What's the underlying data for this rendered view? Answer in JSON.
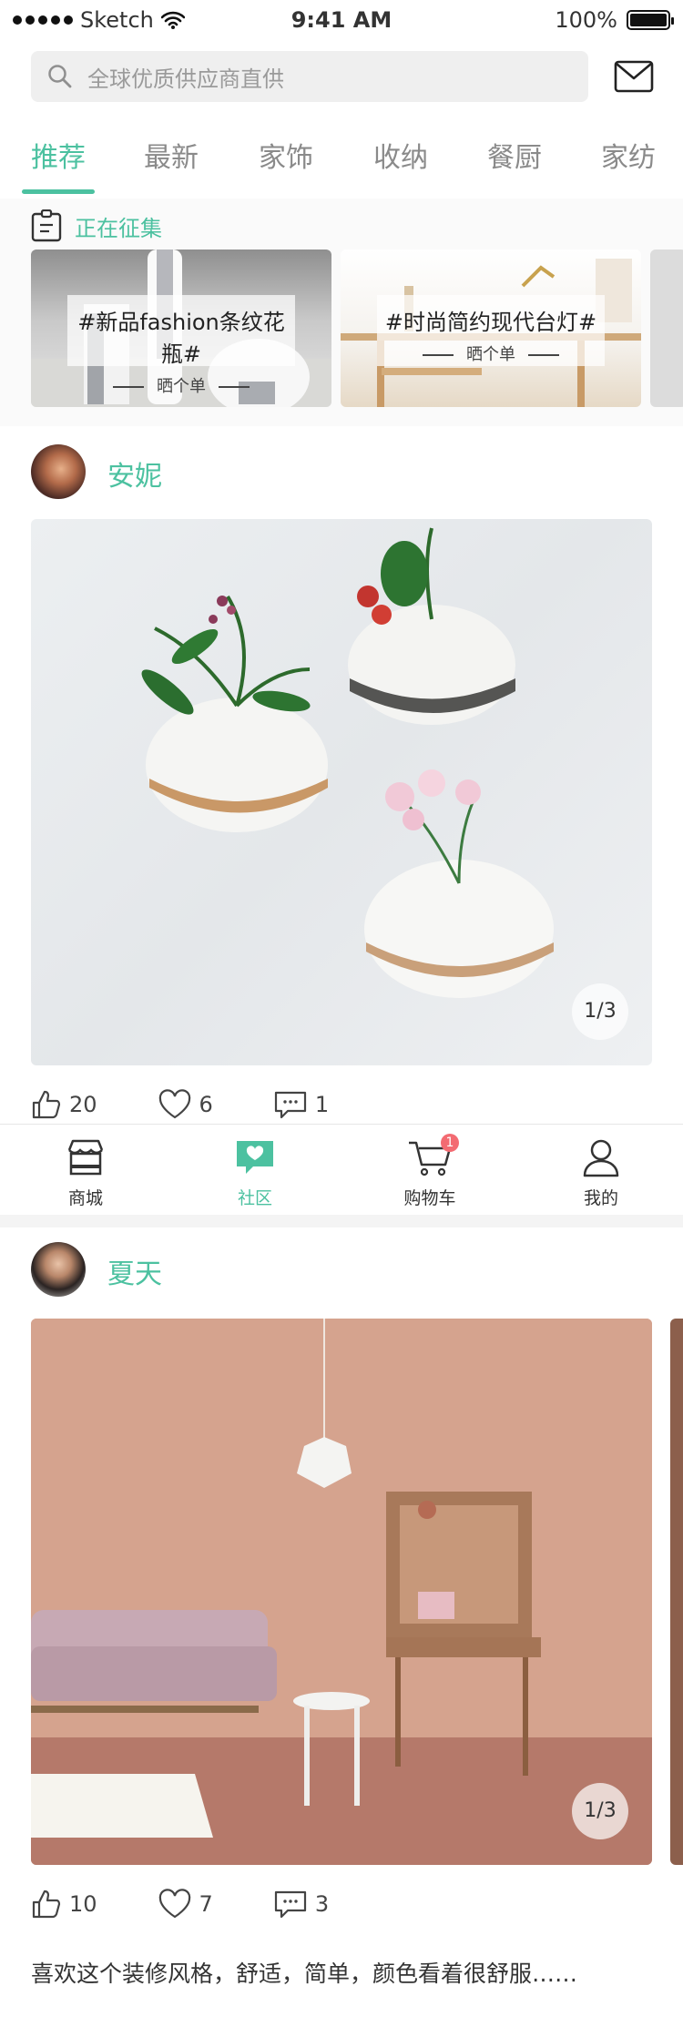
{
  "status_bar": {
    "carrier": "Sketch",
    "time": "9:41 AM",
    "battery": "100%"
  },
  "search": {
    "placeholder": "全球优质供应商直供",
    "icon": "search-icon"
  },
  "header": {
    "mail_icon": "mail-icon"
  },
  "tabs": [
    {
      "label": "推荐",
      "active": true
    },
    {
      "label": "最新"
    },
    {
      "label": "家饰"
    },
    {
      "label": "收纳"
    },
    {
      "label": "餐厨"
    },
    {
      "label": "家纺"
    }
  ],
  "collecting": {
    "title": "正在征集",
    "icon": "clipboard-icon",
    "cards": [
      {
        "topic": "#新品fashion条纹花瓶#",
        "action": "晒个单"
      },
      {
        "topic": "#时尚简约现代台灯#",
        "action": "晒个单"
      }
    ]
  },
  "posts": [
    {
      "user": "安妮",
      "image_counter": "1/3",
      "likes": "20",
      "favorites": "6",
      "comments": "1"
    },
    {
      "user": "夏天",
      "image_counter": "1/3",
      "likes": "10",
      "favorites": "7",
      "comments": "3",
      "text": "喜欢这个装修风格，舒适，简单，颜色看着很舒服……"
    }
  ],
  "tabbar": {
    "items": [
      {
        "label": "商城",
        "icon": "store-icon"
      },
      {
        "label": "社区",
        "icon": "community-icon",
        "active": true
      },
      {
        "label": "购物车",
        "icon": "cart-icon",
        "badge": "1"
      },
      {
        "label": "我的",
        "icon": "user-icon"
      }
    ]
  },
  "colors": {
    "accent": "#4cc1a0",
    "badge": "#f36b72"
  }
}
